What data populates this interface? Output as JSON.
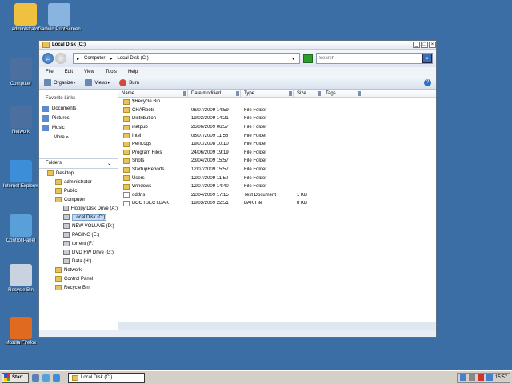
{
  "desktop": {
    "icons": [
      {
        "label": "administrator",
        "color": "#f0c040"
      },
      {
        "label": "Gadwin PrintScreen",
        "color": "#8ab4e0"
      },
      {
        "label": "Computer",
        "color": "#4b6f9e"
      },
      {
        "label": "Network",
        "color": "#4b6f9e"
      },
      {
        "label": "Internet Explorer",
        "color": "#3d8ed8"
      },
      {
        "label": "Control Panel",
        "color": "#5aa0d8"
      },
      {
        "label": "Recycle Bin",
        "color": "#c9d3df"
      },
      {
        "label": "Mozilla Firefox",
        "color": "#e06a20"
      }
    ]
  },
  "window": {
    "title": "Local Disk (C:)",
    "address": {
      "segments": [
        "Computer",
        "Local Disk (C:)"
      ]
    },
    "search_placeholder": "Search",
    "menu": [
      "File",
      "Edit",
      "View",
      "Tools",
      "Help"
    ],
    "toolbar": {
      "organize": "Organize",
      "views": "Views",
      "burn": "Burn"
    },
    "favorites": {
      "title": "Favorite Links",
      "items": [
        "Documents",
        "Pictures",
        "Music"
      ],
      "more": "More »"
    },
    "folders": {
      "title": "Folders",
      "items": [
        {
          "label": "Desktop",
          "indent": 0
        },
        {
          "label": "administrator",
          "indent": 1
        },
        {
          "label": "Public",
          "indent": 1
        },
        {
          "label": "Computer",
          "indent": 1
        },
        {
          "label": "Floppy Disk Drive (A:)",
          "indent": 2
        },
        {
          "label": "Local Disk (C:)",
          "indent": 2
        },
        {
          "label": "NEW VOLUME (D:)",
          "indent": 2
        },
        {
          "label": "PAGING (E:)",
          "indent": 2
        },
        {
          "label": "torrent (F:)",
          "indent": 2
        },
        {
          "label": "DVD RW Drive (G:)",
          "indent": 2
        },
        {
          "label": "Data (H:)",
          "indent": 2
        },
        {
          "label": "Network",
          "indent": 1
        },
        {
          "label": "Control Panel",
          "indent": 1
        },
        {
          "label": "Recycle Bin",
          "indent": 1
        }
      ]
    },
    "columns": [
      "Name",
      "Date modified",
      "Type",
      "Size",
      "Tags"
    ],
    "files": [
      {
        "name": "$Recycle.Bin",
        "date": "",
        "type": "",
        "size": "",
        "kind": "folder"
      },
      {
        "name": "CHARoots",
        "date": "06/07/2009 14:59",
        "type": "File Folder",
        "size": "",
        "kind": "folder"
      },
      {
        "name": "Distribution",
        "date": "19/03/2009 14:21",
        "type": "File Folder",
        "size": "",
        "kind": "folder"
      },
      {
        "name": "inetpub",
        "date": "26/06/2009 06:57",
        "type": "File Folder",
        "size": "",
        "kind": "folder"
      },
      {
        "name": "Intel",
        "date": "06/07/2009 11:56",
        "type": "File Folder",
        "size": "",
        "kind": "folder"
      },
      {
        "name": "PerfLogs",
        "date": "19/01/2008 10:10",
        "type": "File Folder",
        "size": "",
        "kind": "folder"
      },
      {
        "name": "Program Files",
        "date": "24/06/2009 19:19",
        "type": "File Folder",
        "size": "",
        "kind": "folder"
      },
      {
        "name": "Shots",
        "date": "23/04/2009 15:57",
        "type": "File Folder",
        "size": "",
        "kind": "folder"
      },
      {
        "name": "StartupReports",
        "date": "12/07/2009 15:57",
        "type": "File Folder",
        "size": "",
        "kind": "folder"
      },
      {
        "name": "Users",
        "date": "12/07/2009 11:50",
        "type": "File Folder",
        "size": "",
        "kind": "folder"
      },
      {
        "name": "Windows",
        "date": "12/07/2009 14:40",
        "type": "File Folder",
        "size": "",
        "kind": "folder"
      },
      {
        "name": "oddns",
        "date": "22/04/2009 17:15",
        "type": "Text Document",
        "size": "1 KB",
        "kind": "doc"
      },
      {
        "name": "BOOTSECT.BAK",
        "date": "18/03/2009 22:51",
        "type": "BAK File",
        "size": "8 KB",
        "kind": "doc"
      }
    ]
  },
  "taskbar": {
    "start_label": "Start",
    "task_label": "Local Disk (C:)",
    "clock": "15:57"
  }
}
